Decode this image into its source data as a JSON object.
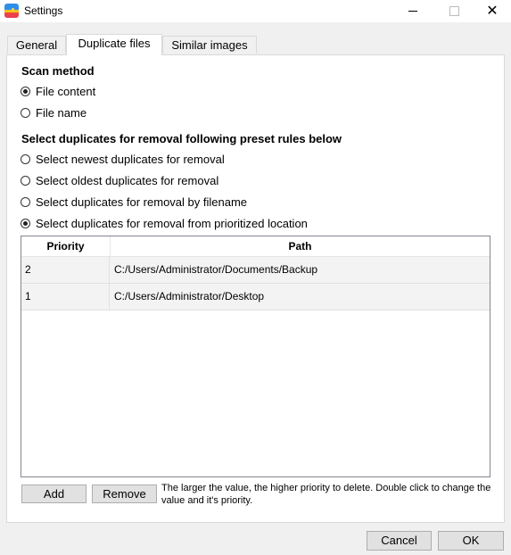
{
  "window": {
    "title": "Settings",
    "icon": "app-logo-icon",
    "controls": {
      "minimize": "minimize-icon",
      "maximize": "maximize-icon",
      "close": "close-icon",
      "close_glyph": "✕"
    }
  },
  "tabs": [
    {
      "label": "General",
      "active": false
    },
    {
      "label": "Duplicate files",
      "active": true
    },
    {
      "label": "Similar images",
      "active": false
    }
  ],
  "scan_method": {
    "title": "Scan method",
    "options": [
      {
        "label": "File content",
        "checked": true
      },
      {
        "label": "File name",
        "checked": false
      }
    ]
  },
  "removal_rules": {
    "title": "Select duplicates for removal following preset rules below",
    "options": [
      {
        "label": "Select newest duplicates for removal",
        "checked": false
      },
      {
        "label": "Select oldest duplicates for removal",
        "checked": false
      },
      {
        "label": "Select duplicates for removal by filename",
        "checked": false
      },
      {
        "label": "Select duplicates for removal from prioritized location",
        "checked": true
      }
    ]
  },
  "locations_table": {
    "columns": [
      "Priority",
      "Path"
    ],
    "rows": [
      {
        "priority": "2",
        "path": "C:/Users/Administrator/Documents/Backup"
      },
      {
        "priority": "1",
        "path": "C:/Users/Administrator/Desktop"
      }
    ]
  },
  "table_actions": {
    "add_label": "Add",
    "remove_label": "Remove",
    "hint": "The larger the value, the higher priority to delete. Double click to change the value and it's priority."
  },
  "footer": {
    "cancel_label": "Cancel",
    "ok_label": "OK"
  }
}
